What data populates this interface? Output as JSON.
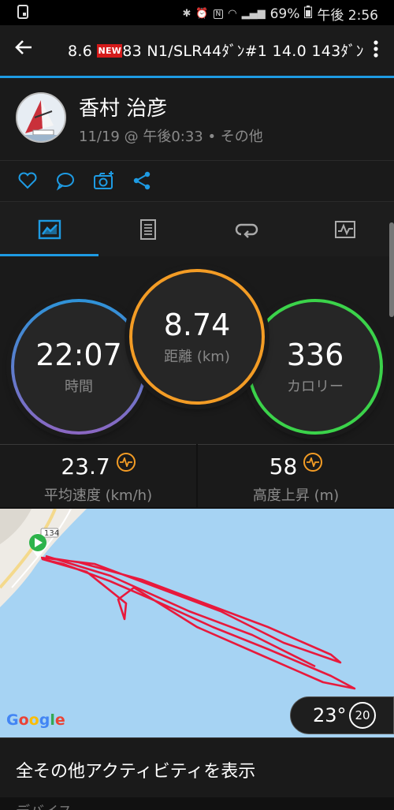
{
  "status_bar": {
    "battery": "69%",
    "time": "午後 2:56"
  },
  "header": {
    "title_prefix": "8.6",
    "new_badge": "NEW",
    "title_suffix": "83  N1/SLR44ﾀﾞﾝ#1  14.0  143ﾀﾞﾝ",
    "back_icon": "back-arrow-icon",
    "menu_icon": "kebab-menu-icon"
  },
  "profile": {
    "name": "香村 治彦",
    "meta": "11/19 @ 午後0:33 • その他"
  },
  "actions": {
    "icons": [
      "heart-icon",
      "comment-icon",
      "camera-add-icon",
      "share-icon"
    ],
    "accent": "#1e9be3"
  },
  "tabs": {
    "items": [
      "summary-tab",
      "details-tab",
      "laps-tab",
      "graphs-tab"
    ],
    "active_index": 0
  },
  "stats": {
    "time": {
      "value": "22:07",
      "label": "時間",
      "color": "#7b6fc2"
    },
    "distance": {
      "value": "8.74",
      "label": "距離 (km)",
      "color": "#f39c25"
    },
    "calories": {
      "value": "336",
      "label": "カロリー",
      "color": "#3bd34a"
    }
  },
  "substats": {
    "speed": {
      "value": "23.7",
      "label": "平均速度 (km/h)"
    },
    "ascent": {
      "value": "58",
      "label": "高度上昇 (m)"
    }
  },
  "map": {
    "road_label": "134",
    "attribution": "Google",
    "temperature": "23°",
    "wind": "20",
    "track_color": "#e8193c"
  },
  "more_link": "全その他アクティビティを表示",
  "next_section": "デバイス"
}
